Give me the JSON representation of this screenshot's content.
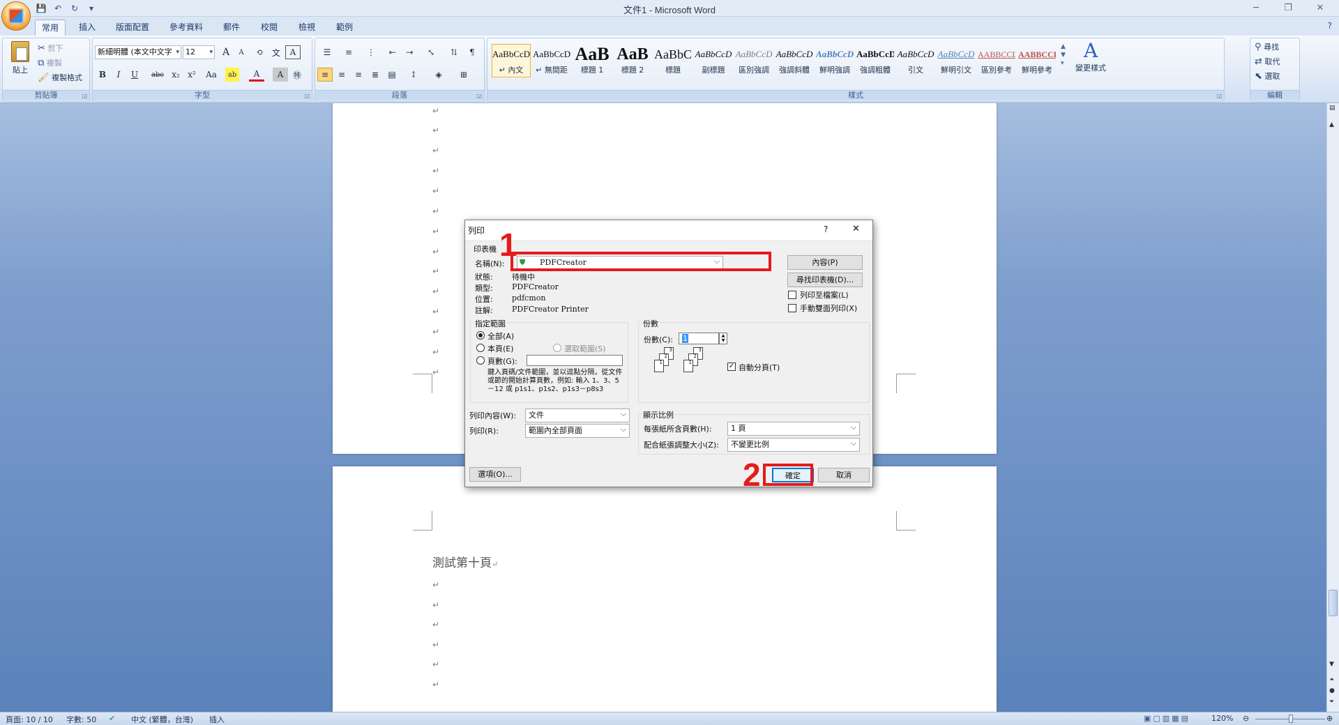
{
  "window": {
    "title": "文件1 - Microsoft Word",
    "controls": [
      "─",
      "❐",
      "✕"
    ]
  },
  "qat": {
    "save_icon": "💾",
    "undo_icon": "↶",
    "redo_icon": "↻",
    "more_icon": "▾"
  },
  "tabs": [
    "常用",
    "插入",
    "版面配置",
    "參考資料",
    "郵件",
    "校閱",
    "檢視",
    "範例"
  ],
  "ribbon": {
    "help": "?",
    "clipboard": {
      "label": "剪貼簿",
      "paste": "貼上",
      "cut": "剪下",
      "copy": "複製",
      "format_painter": "複製格式"
    },
    "font": {
      "label": "字型",
      "name": "新細明體 (本文中文字",
      "size": "12",
      "grow": "A",
      "shrink": "A",
      "bold": "B",
      "italic": "I",
      "underline": "U",
      "strike": "abc",
      "sub": "x₂",
      "sup": "x²",
      "case": "Aa",
      "highlight": "ab",
      "color": "A",
      "char_shading": "A",
      "enclose": "㊕"
    },
    "paragraph": {
      "label": "段落"
    },
    "styles": {
      "label": "樣式",
      "items": [
        {
          "preview": "AaBbCcD",
          "name": "↵ 內文"
        },
        {
          "preview": "AaBbCcD",
          "name": "↵ 無間距"
        },
        {
          "preview": "AaB",
          "name": "標題 1"
        },
        {
          "preview": "AaB",
          "name": "標題 2"
        },
        {
          "preview": "AaBbC",
          "name": "標題"
        },
        {
          "preview": "AaBbCcD",
          "name": "副標題"
        },
        {
          "preview": "AaBbCcD",
          "name": "區別強調"
        },
        {
          "preview": "AaBbCcD",
          "name": "強調斜體"
        },
        {
          "preview": "AaBbCcD",
          "name": "鮮明強調"
        },
        {
          "preview": "AaBbCcD",
          "name": "強調粗體"
        },
        {
          "preview": "AaBbCcD",
          "name": "引文"
        },
        {
          "preview": "AaBbCcD",
          "name": "鮮明引文"
        },
        {
          "preview": "AABBCCD",
          "name": "區別參考"
        },
        {
          "preview": "AABBCCD",
          "name": "鮮明參考"
        }
      ],
      "change": "變更樣式"
    },
    "editing": {
      "label": "編輯",
      "find": "尋找",
      "replace": "取代",
      "select": "選取"
    }
  },
  "document": {
    "para_mark": "↵",
    "page2_text": "測試第十頁"
  },
  "dialog": {
    "title": "列印",
    "help": "?",
    "close": "✕",
    "printer": {
      "legend": "印表機",
      "name_label": "名稱(N):",
      "name_value": "PDFCreator",
      "status_label": "狀態:",
      "status_value": "待機中",
      "type_label": "類型:",
      "type_value": "PDFCreator",
      "where_label": "位置:",
      "where_value": "pdfcmon",
      "comment_label": "註解:",
      "comment_value": "PDFCreator Printer",
      "properties_button": "內容(P)",
      "find_printer_button": "尋找印表機(D)...",
      "print_to_file": "列印至檔案(L)",
      "manual_duplex": "手動雙面列印(X)"
    },
    "range": {
      "legend": "指定範圍",
      "all": "全部(A)",
      "current": "本頁(E)",
      "selection": "選取範圍(S)",
      "pages": "頁數(G):",
      "hint": "鍵入頁碼/文件範圍，並以逗點分隔，從文件或節的開始計算頁數，例如: 輸入 1、3、5－12 或 p1s1、p1s2、p1s3－p8s3"
    },
    "copies": {
      "legend": "份數",
      "label": "份數(C):",
      "value": "1",
      "collate": "自動分頁(T)",
      "collate_checked": "✓"
    },
    "print_what_label": "列印內容(W):",
    "print_what_value": "文件",
    "print_label": "列印(R):",
    "print_value": "範圍內全部頁面",
    "zoom": {
      "legend": "顯示比例",
      "pages_label": "每張紙所含頁數(H):",
      "pages_value": "1 頁",
      "scale_label": "配合紙張調整大小(Z):",
      "scale_value": "不變更比例"
    },
    "options_button": "選項(O)...",
    "ok_button": "確定",
    "cancel_button": "取消"
  },
  "annotations": {
    "step1": "1",
    "step2": "2",
    "color": "#e31b1b"
  },
  "statusbar": {
    "page": "頁面: 10 / 10",
    "words": "字數: 50",
    "language": "中文 (繁體，台灣)",
    "mode": "插入",
    "zoom": "120%"
  }
}
